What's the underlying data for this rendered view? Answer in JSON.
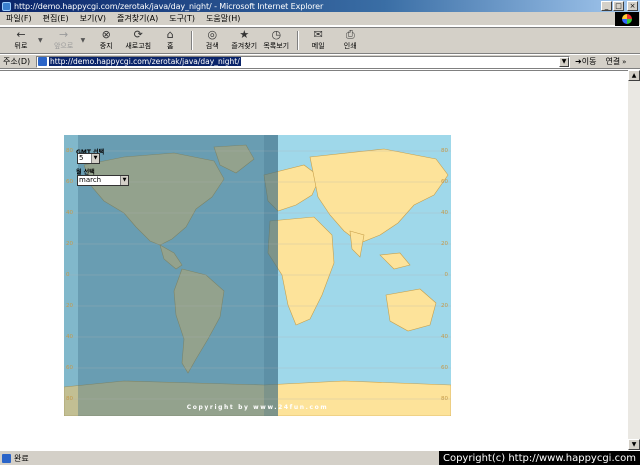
{
  "window": {
    "title": "http://demo.happycgi.com/zerotak/java/day_night/ - Microsoft Internet Explorer",
    "buttons": {
      "minimize": "_",
      "maximize": "□",
      "close": "×"
    }
  },
  "menu": [
    "파일(F)",
    "편집(E)",
    "보기(V)",
    "즐겨찾기(A)",
    "도구(T)",
    "도움말(H)"
  ],
  "toolbar": {
    "back": "뒤로",
    "forward": "앞으로",
    "stop": "중지",
    "refresh": "새로고침",
    "home": "홈",
    "search": "검색",
    "favorites": "즐겨찾기",
    "history": "목록보기",
    "mail": "메일",
    "print": "인쇄",
    "icons": {
      "back": "←",
      "forward": "→",
      "stop": "⊗",
      "refresh": "⟳",
      "home": "⌂",
      "search": "◎",
      "favorites": "★",
      "history": "◷",
      "mail": "✉",
      "print": "⎙"
    }
  },
  "address": {
    "label": "주소(D)",
    "url": "http://demo.happycgi.com/zerotak/java/day_night/",
    "go": "이동",
    "links": "연결"
  },
  "map": {
    "gmt_label": "GMT 선택",
    "gmt_value": "5",
    "month_label": "월 선택",
    "month_value": "march",
    "copyright": "Copyright by www.24fun.com",
    "lat_labels": [
      "80",
      "60",
      "40",
      "20",
      "0",
      "20",
      "40",
      "60",
      "80"
    ],
    "colors": {
      "ocean": "#9fd8ea",
      "land": "#fde39a",
      "night": "#3c6d84"
    }
  },
  "status": {
    "text": "완료",
    "site_copyright": "Copyright(c) http://www.happycgi.com"
  }
}
